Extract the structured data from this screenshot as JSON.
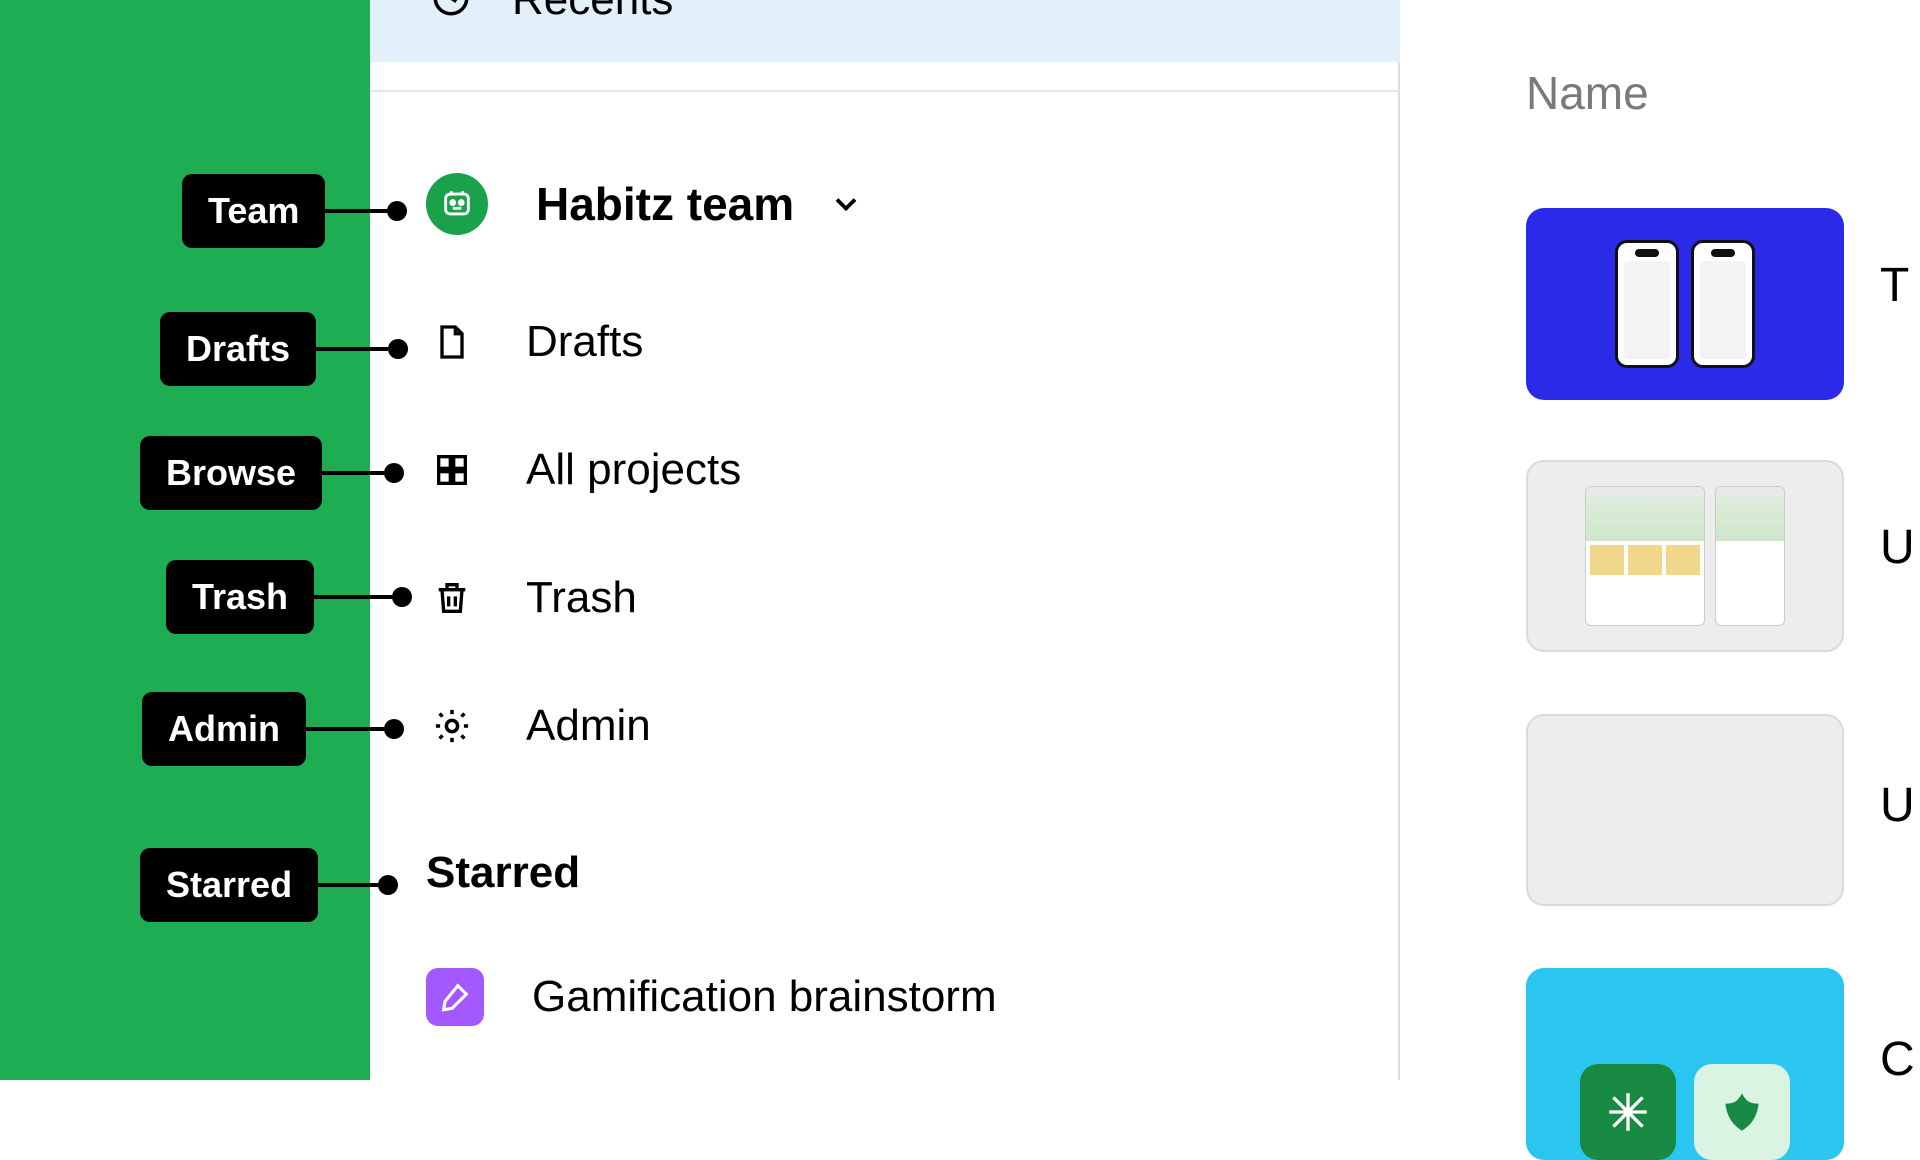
{
  "callouts": {
    "team": "Team",
    "drafts": "Drafts",
    "browse": "Browse",
    "trash": "Trash",
    "admin": "Admin",
    "starred": "Starred"
  },
  "sidebar": {
    "recents_label": "Recents",
    "team_name": "Habitz team",
    "items": {
      "drafts": "Drafts",
      "all_projects": "All projects",
      "trash": "Trash",
      "admin": "Admin"
    },
    "starred_header": "Starred",
    "starred_items": [
      {
        "label": "Gamification brainstorm"
      }
    ]
  },
  "content": {
    "column_header": "Name",
    "edge_letters": [
      "T",
      "U",
      "U",
      "C"
    ]
  },
  "colors": {
    "green_band": "#1EAD52",
    "recents_bg": "#E1F0FA",
    "team_avatar": "#19A24A",
    "starred_icon": "#A259FF",
    "thumb_blue": "#2B2AE8",
    "thumb_cyan": "#2AC6F0"
  }
}
